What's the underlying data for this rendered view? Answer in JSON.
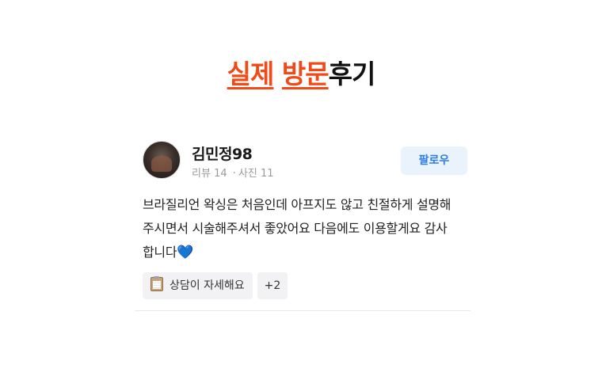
{
  "heading": {
    "part1": "실제",
    "part2": "방문",
    "part3": "후기"
  },
  "review": {
    "author": "김민정98",
    "review_label": "리뷰",
    "review_count": "14",
    "photo_label": "사진",
    "photo_count": "11",
    "follow_label": "팔로우",
    "text_line1": "브라질리언 왁싱은 처음인데 아프지도 않고 친절하게 설명해",
    "text_line2": "주시면서 시술해주셔서 좋았어요 다음에도 이용할게요 감사",
    "text_line3": "합니다",
    "heart": "💙",
    "tags": [
      {
        "icon": "clipboard-icon",
        "label": "상담이 자세해요"
      },
      {
        "label": "+2"
      }
    ]
  },
  "colors": {
    "accent_orange": "#f14a16",
    "follow_blue": "#2f7de1",
    "follow_bg": "#eaf3fc"
  }
}
